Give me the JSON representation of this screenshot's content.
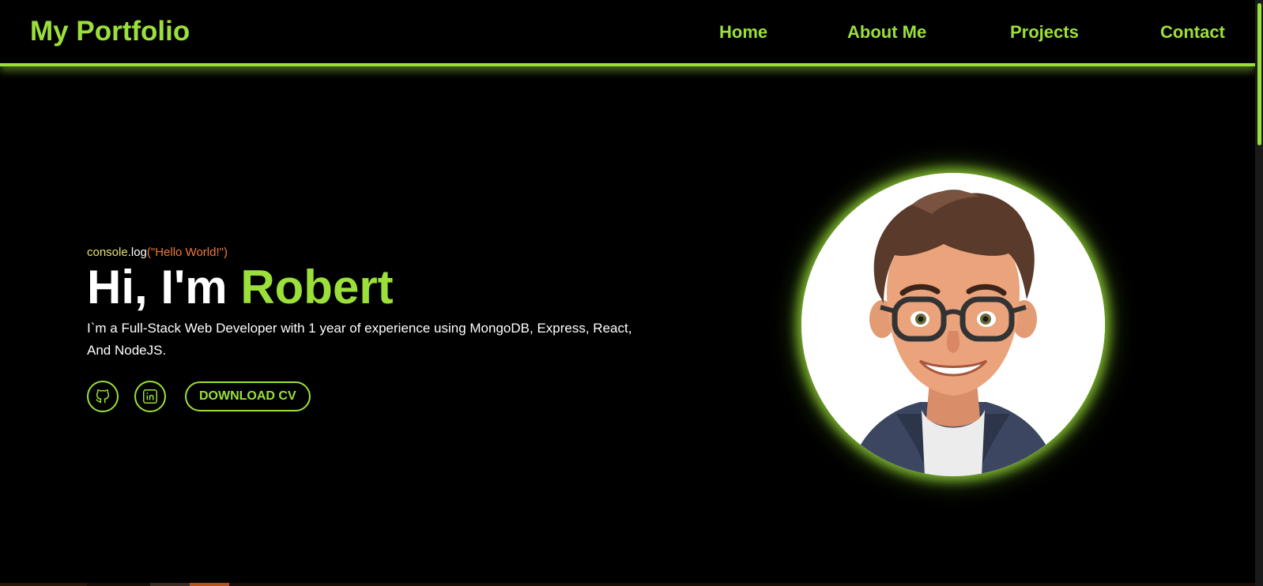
{
  "navbar": {
    "logo": "My Portfolio",
    "links": [
      {
        "label": "Home"
      },
      {
        "label": "About Me"
      },
      {
        "label": "Projects"
      },
      {
        "label": "Contact"
      }
    ]
  },
  "hero": {
    "console_obj": "console",
    "console_dot": ".log",
    "console_str": "(\"Hello World!\")",
    "greeting": "Hi, I'm",
    "name": "Robert",
    "description": "I`m a Full-Stack Web Developer with 1 year of experience using MongoDB, Express, React, And NodeJS.",
    "download_label": "DOWNLOAD CV",
    "icons": [
      "github-icon",
      "linkedin-icon"
    ]
  },
  "avatar": {
    "icon": "developer-avatar"
  },
  "colors": {
    "accent": "#9be03a",
    "background": "#000000",
    "text": "#ffffff",
    "console_object": "#e6e26a",
    "console_string": "#f07a3a"
  }
}
